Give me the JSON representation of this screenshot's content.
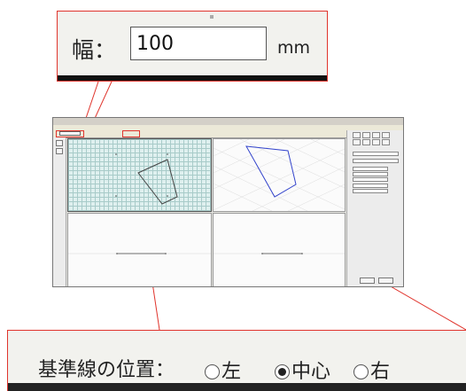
{
  "callout_width": {
    "label": "幅：",
    "value": "100",
    "unit": "mm"
  },
  "callout_baseline": {
    "label": "基準線の位置：",
    "options": [
      "左",
      "中心",
      "右"
    ],
    "selected": "中心"
  },
  "colors": {
    "callout_border": "#e0342c",
    "polygon_stroke_top_left": "#444444",
    "polygon_stroke_iso": "#3344cc",
    "grid": "#a8cbc9"
  }
}
